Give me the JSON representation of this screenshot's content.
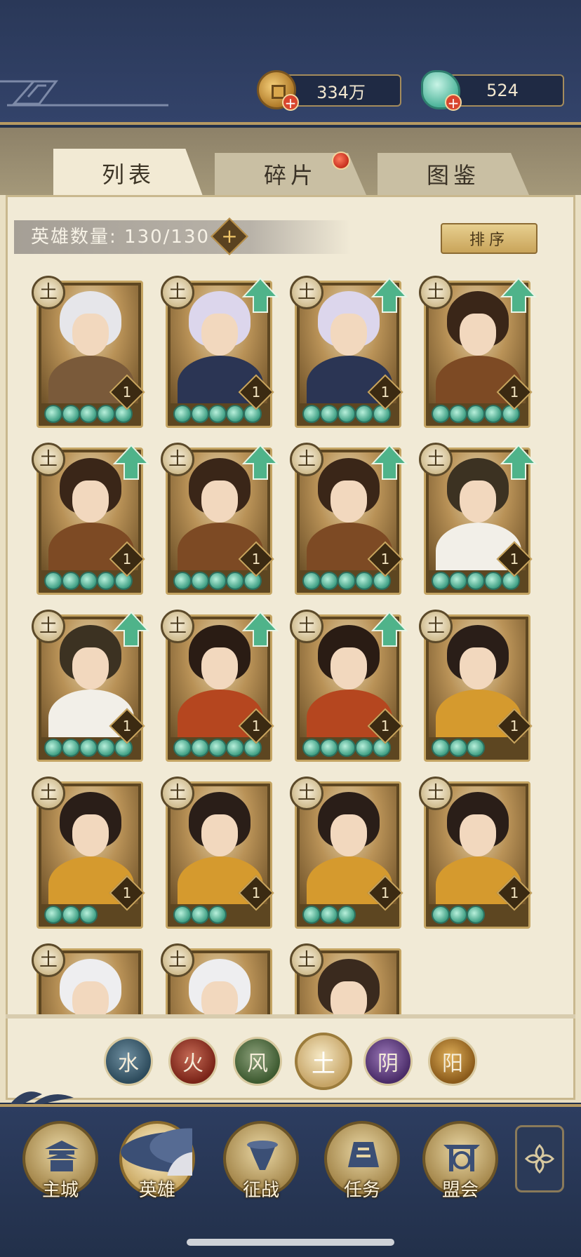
{
  "resources": {
    "coins": "334万",
    "jade": "524"
  },
  "tabs": [
    {
      "label": "列表",
      "active": true
    },
    {
      "label": "碎片",
      "active": false,
      "has_notification": true
    },
    {
      "label": "图鉴",
      "active": false
    }
  ],
  "hero_count": {
    "label": "英雄数量: 130/130"
  },
  "sort_label": "排序",
  "heroes": [
    {
      "element_glyph": "土",
      "level": "1",
      "stars": 5,
      "can_upgrade": false
    },
    {
      "element_glyph": "土",
      "level": "1",
      "stars": 5,
      "can_upgrade": true
    },
    {
      "element_glyph": "土",
      "level": "1",
      "stars": 5,
      "can_upgrade": true
    },
    {
      "element_glyph": "土",
      "level": "1",
      "stars": 5,
      "can_upgrade": true
    },
    {
      "element_glyph": "土",
      "level": "1",
      "stars": 5,
      "can_upgrade": true
    },
    {
      "element_glyph": "土",
      "level": "1",
      "stars": 5,
      "can_upgrade": true
    },
    {
      "element_glyph": "土",
      "level": "1",
      "stars": 5,
      "can_upgrade": true
    },
    {
      "element_glyph": "土",
      "level": "1",
      "stars": 5,
      "can_upgrade": true
    },
    {
      "element_glyph": "土",
      "level": "1",
      "stars": 5,
      "can_upgrade": true
    },
    {
      "element_glyph": "土",
      "level": "1",
      "stars": 5,
      "can_upgrade": true
    },
    {
      "element_glyph": "土",
      "level": "1",
      "stars": 5,
      "can_upgrade": true
    },
    {
      "element_glyph": "土",
      "level": "1",
      "stars": 3,
      "can_upgrade": false
    },
    {
      "element_glyph": "土",
      "level": "1",
      "stars": 3,
      "can_upgrade": false
    },
    {
      "element_glyph": "土",
      "level": "1",
      "stars": 3,
      "can_upgrade": false
    },
    {
      "element_glyph": "土",
      "level": "1",
      "stars": 3,
      "can_upgrade": false
    },
    {
      "element_glyph": "土",
      "level": "1",
      "stars": 3,
      "can_upgrade": false
    },
    {
      "element_glyph": "土",
      "level": "",
      "stars": 0,
      "can_upgrade": false
    },
    {
      "element_glyph": "土",
      "level": "",
      "stars": 0,
      "can_upgrade": false
    },
    {
      "element_glyph": "土",
      "level": "",
      "stars": 0,
      "can_upgrade": false
    }
  ],
  "element_filters": [
    {
      "glyph": "水",
      "selected": false
    },
    {
      "glyph": "火",
      "selected": false
    },
    {
      "glyph": "风",
      "selected": false
    },
    {
      "glyph": "土",
      "selected": true
    },
    {
      "glyph": "阴",
      "selected": false
    },
    {
      "glyph": "阳",
      "selected": false
    }
  ],
  "nav": [
    {
      "label": "主城",
      "active": false
    },
    {
      "label": "英雄",
      "active": true
    },
    {
      "label": "征战",
      "active": false
    },
    {
      "label": "任务",
      "active": false
    },
    {
      "label": "盟会",
      "active": false
    }
  ],
  "colors": {
    "frame_gold": "#c4a462",
    "upgrade_green": "#4fb38a",
    "notification_red": "#c52d1d"
  }
}
